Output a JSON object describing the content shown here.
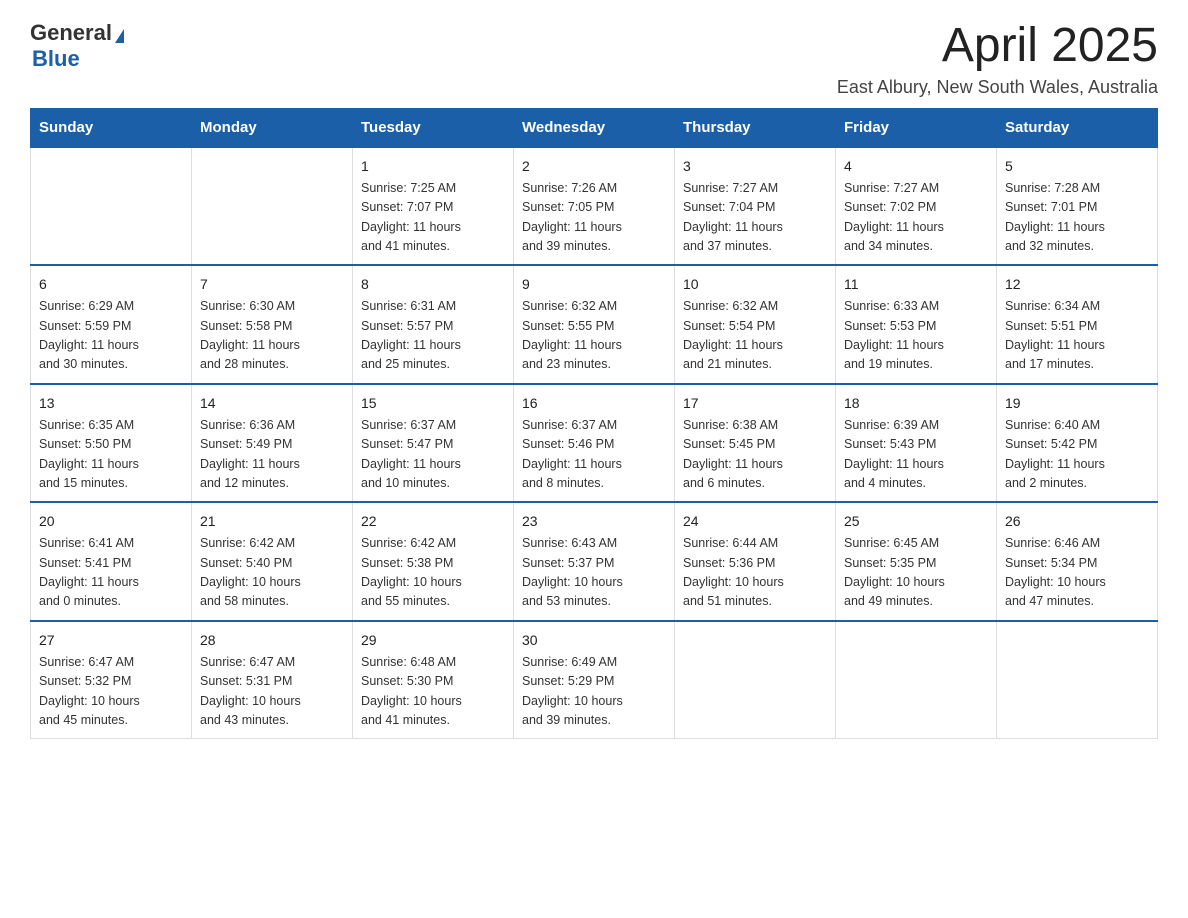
{
  "header": {
    "logo_general": "General",
    "logo_blue": "Blue",
    "month_title": "April 2025",
    "location": "East Albury, New South Wales, Australia"
  },
  "days_of_week": [
    "Sunday",
    "Monday",
    "Tuesday",
    "Wednesday",
    "Thursday",
    "Friday",
    "Saturday"
  ],
  "weeks": [
    [
      {
        "day": "",
        "info": ""
      },
      {
        "day": "",
        "info": ""
      },
      {
        "day": "1",
        "info": "Sunrise: 7:25 AM\nSunset: 7:07 PM\nDaylight: 11 hours\nand 41 minutes."
      },
      {
        "day": "2",
        "info": "Sunrise: 7:26 AM\nSunset: 7:05 PM\nDaylight: 11 hours\nand 39 minutes."
      },
      {
        "day": "3",
        "info": "Sunrise: 7:27 AM\nSunset: 7:04 PM\nDaylight: 11 hours\nand 37 minutes."
      },
      {
        "day": "4",
        "info": "Sunrise: 7:27 AM\nSunset: 7:02 PM\nDaylight: 11 hours\nand 34 minutes."
      },
      {
        "day": "5",
        "info": "Sunrise: 7:28 AM\nSunset: 7:01 PM\nDaylight: 11 hours\nand 32 minutes."
      }
    ],
    [
      {
        "day": "6",
        "info": "Sunrise: 6:29 AM\nSunset: 5:59 PM\nDaylight: 11 hours\nand 30 minutes."
      },
      {
        "day": "7",
        "info": "Sunrise: 6:30 AM\nSunset: 5:58 PM\nDaylight: 11 hours\nand 28 minutes."
      },
      {
        "day": "8",
        "info": "Sunrise: 6:31 AM\nSunset: 5:57 PM\nDaylight: 11 hours\nand 25 minutes."
      },
      {
        "day": "9",
        "info": "Sunrise: 6:32 AM\nSunset: 5:55 PM\nDaylight: 11 hours\nand 23 minutes."
      },
      {
        "day": "10",
        "info": "Sunrise: 6:32 AM\nSunset: 5:54 PM\nDaylight: 11 hours\nand 21 minutes."
      },
      {
        "day": "11",
        "info": "Sunrise: 6:33 AM\nSunset: 5:53 PM\nDaylight: 11 hours\nand 19 minutes."
      },
      {
        "day": "12",
        "info": "Sunrise: 6:34 AM\nSunset: 5:51 PM\nDaylight: 11 hours\nand 17 minutes."
      }
    ],
    [
      {
        "day": "13",
        "info": "Sunrise: 6:35 AM\nSunset: 5:50 PM\nDaylight: 11 hours\nand 15 minutes."
      },
      {
        "day": "14",
        "info": "Sunrise: 6:36 AM\nSunset: 5:49 PM\nDaylight: 11 hours\nand 12 minutes."
      },
      {
        "day": "15",
        "info": "Sunrise: 6:37 AM\nSunset: 5:47 PM\nDaylight: 11 hours\nand 10 minutes."
      },
      {
        "day": "16",
        "info": "Sunrise: 6:37 AM\nSunset: 5:46 PM\nDaylight: 11 hours\nand 8 minutes."
      },
      {
        "day": "17",
        "info": "Sunrise: 6:38 AM\nSunset: 5:45 PM\nDaylight: 11 hours\nand 6 minutes."
      },
      {
        "day": "18",
        "info": "Sunrise: 6:39 AM\nSunset: 5:43 PM\nDaylight: 11 hours\nand 4 minutes."
      },
      {
        "day": "19",
        "info": "Sunrise: 6:40 AM\nSunset: 5:42 PM\nDaylight: 11 hours\nand 2 minutes."
      }
    ],
    [
      {
        "day": "20",
        "info": "Sunrise: 6:41 AM\nSunset: 5:41 PM\nDaylight: 11 hours\nand 0 minutes."
      },
      {
        "day": "21",
        "info": "Sunrise: 6:42 AM\nSunset: 5:40 PM\nDaylight: 10 hours\nand 58 minutes."
      },
      {
        "day": "22",
        "info": "Sunrise: 6:42 AM\nSunset: 5:38 PM\nDaylight: 10 hours\nand 55 minutes."
      },
      {
        "day": "23",
        "info": "Sunrise: 6:43 AM\nSunset: 5:37 PM\nDaylight: 10 hours\nand 53 minutes."
      },
      {
        "day": "24",
        "info": "Sunrise: 6:44 AM\nSunset: 5:36 PM\nDaylight: 10 hours\nand 51 minutes."
      },
      {
        "day": "25",
        "info": "Sunrise: 6:45 AM\nSunset: 5:35 PM\nDaylight: 10 hours\nand 49 minutes."
      },
      {
        "day": "26",
        "info": "Sunrise: 6:46 AM\nSunset: 5:34 PM\nDaylight: 10 hours\nand 47 minutes."
      }
    ],
    [
      {
        "day": "27",
        "info": "Sunrise: 6:47 AM\nSunset: 5:32 PM\nDaylight: 10 hours\nand 45 minutes."
      },
      {
        "day": "28",
        "info": "Sunrise: 6:47 AM\nSunset: 5:31 PM\nDaylight: 10 hours\nand 43 minutes."
      },
      {
        "day": "29",
        "info": "Sunrise: 6:48 AM\nSunset: 5:30 PM\nDaylight: 10 hours\nand 41 minutes."
      },
      {
        "day": "30",
        "info": "Sunrise: 6:49 AM\nSunset: 5:29 PM\nDaylight: 10 hours\nand 39 minutes."
      },
      {
        "day": "",
        "info": ""
      },
      {
        "day": "",
        "info": ""
      },
      {
        "day": "",
        "info": ""
      }
    ]
  ]
}
